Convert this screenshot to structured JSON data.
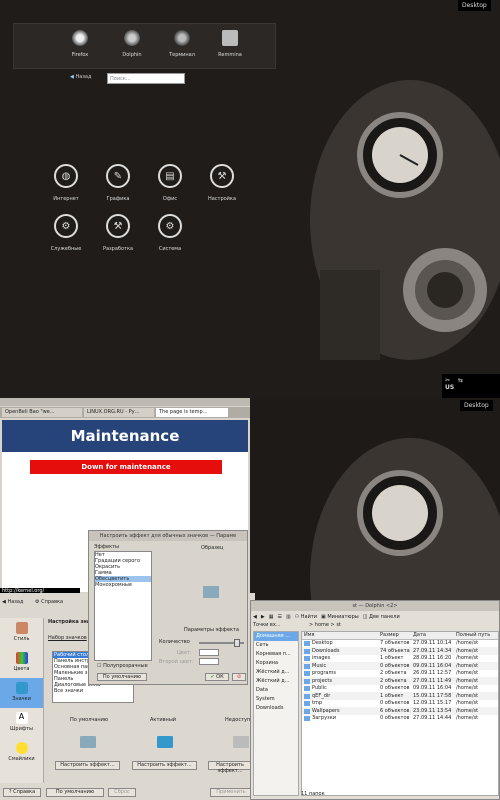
{
  "desktop_badge_top": "Desktop",
  "desktop_badge_bottom": "Desktop",
  "favorites": [
    "Firefox",
    "Dolphin",
    "Терминал",
    "Remmina"
  ],
  "back_label": "Назад",
  "search_placeholder": "Поиск...",
  "categories": [
    "Интернет",
    "Графика",
    "Офис",
    "Настройка",
    "Служебные",
    "Разработка",
    "Система"
  ],
  "tray_lang": "US",
  "browser": {
    "tabs": [
      "OpenBeli Bao \"we...",
      "LINUX.ORG.RU - Ру...",
      "The page is temp..."
    ],
    "heading": "Maintenance",
    "banner": "Down for maintenance",
    "status_url": "http://kernel.org/"
  },
  "sysdialog": {
    "nav_back": "Назад",
    "nav_help": "Справка",
    "side_items": [
      "Стиль",
      "Цвета",
      "Значки",
      "Шрифты",
      "Смайлики"
    ],
    "panel_title": "Настройка зна",
    "sets_label": "Набор значков",
    "list_items": [
      "Рабочий стол",
      "Панель инстр",
      "Основная пан",
      "Маленькие зн",
      "Панель",
      "Диалоговые окна",
      "Все значки"
    ],
    "col_default": "По умолчанию",
    "col_active": "Активный",
    "col_disabled": "Недоступ",
    "btn_set_effect": "Настроить эффект...",
    "btn_help": "Справка",
    "btn_defaults": "По умолчанию",
    "btn_reset": "Сброс",
    "btn_apply": "Применить"
  },
  "effect": {
    "title": "Настроить эффект для обычных значков — Параме",
    "effects_label": "Эффекты",
    "effects": [
      "Нет",
      "Градации серого",
      "Окрасить",
      "Гамма",
      "Обесцветить",
      "Монохромные"
    ],
    "selected": "Обесцветить",
    "sample_label": "Образец",
    "params_label": "Параметры эффекта",
    "amount_label": "Количество",
    "color_label": "Цвет:",
    "color2_label": "Второй цвет:",
    "semi_label": "Полупрозрачные",
    "btn_defaults": "По умолчанию",
    "btn_ok": "ОК"
  },
  "dolphin": {
    "title": "st — Dolphin <2>",
    "toolbar": [
      "Найти",
      "Миниатюры",
      "Две панели"
    ],
    "places_label": "Точки вх...",
    "breadcrumb": "> home > st",
    "places": [
      "Домашняя ...",
      "Сеть",
      "Корневая п...",
      "Корзина",
      "Жёсткий д...",
      "Жёсткий д...",
      "Data",
      "System",
      "Downloads"
    ],
    "columns": [
      "Имя",
      "Размер",
      "Дата",
      "Полный путь"
    ],
    "rows": [
      [
        "Desktop",
        "7 объектов",
        "27.09.11 10:14",
        "/home/st"
      ],
      [
        "Downloads",
        "74 объекта",
        "27.09.11 14:34",
        "/home/st"
      ],
      [
        "images",
        "1 объект",
        "28.09.11 16:20",
        "/home/st"
      ],
      [
        "Music",
        "0 объектов",
        "09.09.11 16:04",
        "/home/st"
      ],
      [
        "programs",
        "2 объекта",
        "26.09.11 12:57",
        "/home/st"
      ],
      [
        "projects",
        "2 объекта",
        "27.09.11 11:49",
        "/home/st"
      ],
      [
        "Public",
        "0 объектов",
        "09.09.11 16:04",
        "/home/st"
      ],
      [
        "qEF_dir",
        "1 объект",
        "15.09.11 17:58",
        "/home/st"
      ],
      [
        "tmp",
        "0 объектов",
        "12.09.11 15:17",
        "/home/st"
      ],
      [
        "Wallpapers",
        "6 объектов",
        "23.09.11 13:54",
        "/home/st"
      ],
      [
        "Загрузки",
        "0 объектов",
        "27.09.11 14:44",
        "/home/st"
      ]
    ],
    "status": "11 папок"
  }
}
